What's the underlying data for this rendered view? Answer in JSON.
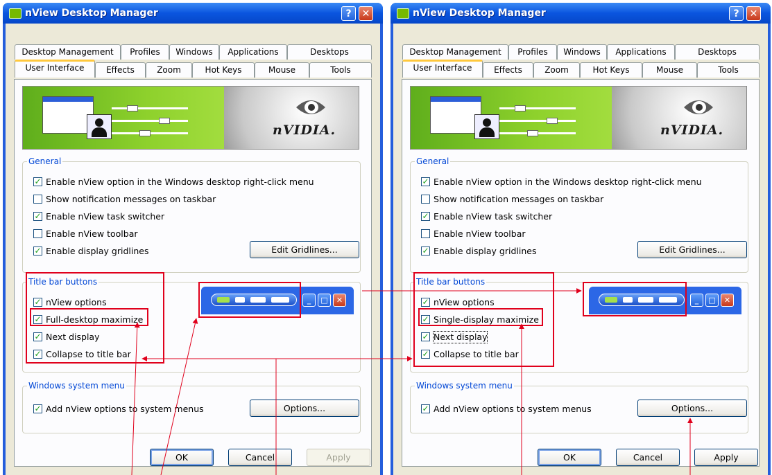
{
  "left_window": {
    "title": "nView Desktop Manager",
    "tabs_row1": [
      "Desktop Management",
      "Profiles",
      "Windows",
      "Applications",
      "Desktops"
    ],
    "tabs_row2": [
      "User Interface",
      "Effects",
      "Zoom",
      "Hot Keys",
      "Mouse",
      "Tools"
    ],
    "active_tab": "User Interface",
    "banner_brand": "nVIDIA.",
    "general": {
      "legend": "General",
      "items": [
        {
          "label": "Enable nView option in the Windows desktop right-click menu",
          "checked": true
        },
        {
          "label": "Show notification messages on taskbar",
          "checked": false
        },
        {
          "label": "Enable nView task switcher",
          "checked": true
        },
        {
          "label": "Enable nView toolbar",
          "checked": false
        },
        {
          "label": "Enable display gridlines",
          "checked": true
        }
      ],
      "edit_gridlines": "Edit Gridlines..."
    },
    "title_bar_buttons": {
      "legend": "Title bar buttons",
      "items": [
        {
          "label": "nView options",
          "checked": true
        },
        {
          "label": "Full-desktop maximize",
          "checked": true
        },
        {
          "label": "Next display",
          "checked": true
        },
        {
          "label": "Collapse to title bar",
          "checked": true
        }
      ]
    },
    "system_menu": {
      "legend": "Windows system menu",
      "item": {
        "label": "Add nView options to system menus",
        "checked": true
      },
      "options_button": "Options..."
    },
    "ok": "OK",
    "cancel": "Cancel",
    "apply": "Apply"
  },
  "right_window": {
    "title": "nView Desktop Manager",
    "tabs_row1": [
      "Desktop Management",
      "Profiles",
      "Windows",
      "Applications",
      "Desktops"
    ],
    "tabs_row2": [
      "User Interface",
      "Effects",
      "Zoom",
      "Hot Keys",
      "Mouse",
      "Tools"
    ],
    "active_tab": "User Interface",
    "banner_brand": "nVIDIA.",
    "general": {
      "legend": "General",
      "items": [
        {
          "label": "Enable nView option in the Windows desktop right-click menu",
          "checked": true
        },
        {
          "label": "Show notification messages on taskbar",
          "checked": false
        },
        {
          "label": "Enable nView task switcher",
          "checked": true
        },
        {
          "label": "Enable nView toolbar",
          "checked": false
        },
        {
          "label": "Enable display gridlines",
          "checked": true
        }
      ],
      "edit_gridlines": "Edit Gridlines..."
    },
    "title_bar_buttons": {
      "legend": "Title bar buttons",
      "items": [
        {
          "label": "nView options",
          "checked": true
        },
        {
          "label": "Single-display maximize",
          "checked": true
        },
        {
          "label": "Next display",
          "checked": true
        },
        {
          "label": "Collapse to title bar",
          "checked": true
        }
      ]
    },
    "system_menu": {
      "legend": "Windows system menu",
      "item": {
        "label": "Add nView options to system menus",
        "checked": true
      },
      "options_button": "Options..."
    },
    "ok": "OK",
    "cancel": "Cancel",
    "apply": "Apply"
  },
  "colors": {
    "annotation_red": "#e0001c",
    "xp_blue": "#245edc",
    "nvidia_green": "#76b900"
  }
}
